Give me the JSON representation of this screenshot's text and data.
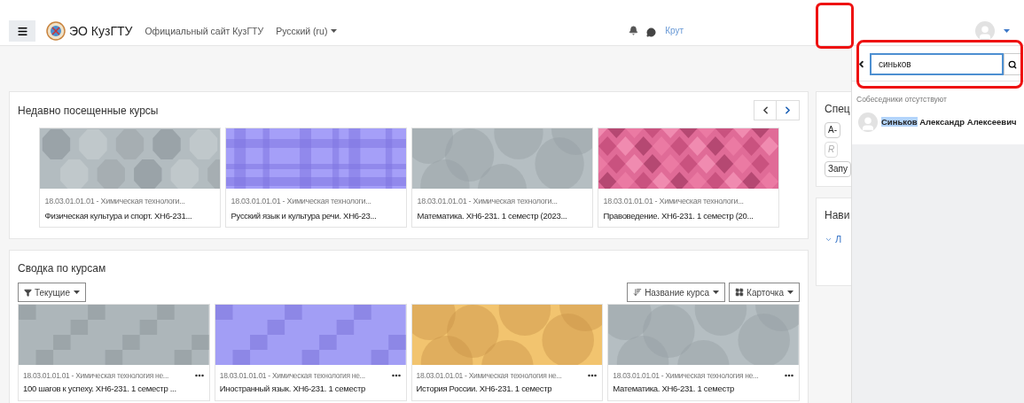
{
  "header": {
    "brand": "ЭО КузГТУ",
    "links": [
      {
        "label": "Официальный сайт КузГТУ",
        "dropdown": false
      },
      {
        "label": "Русский (ru)",
        "dropdown": true
      }
    ],
    "user_name": "Крут"
  },
  "recent": {
    "title": "Недавно посещенные курсы",
    "courses": [
      {
        "category": "18.03.01.01.01 - Химическая технологи...",
        "name": "Физическая культура и спорт. ХН6-231..."
      },
      {
        "category": "18.03.01.01.01 - Химическая технологи...",
        "name": "Русский язык и культура речи. ХН6-23..."
      },
      {
        "category": "18.03.01.01.01 - Химическая технологи...",
        "name": "Математика. ХН6-231. 1 семестр (2023..."
      },
      {
        "category": "18.03.01.01.01 - Химическая технологи...",
        "name": "Правоведение. ХН6-231. 1 семестр (20..."
      }
    ]
  },
  "overview": {
    "title": "Сводка по курсам",
    "filter": "Текущие",
    "sort": "Название курса",
    "view": "Карточка",
    "courses": [
      {
        "category": "18.03.01.01.01 - Химическая технология не...",
        "name": "100 шагов к успеху. ХН6-231. 1 семестр ..."
      },
      {
        "category": "18.03.01.01.01 - Химическая технология не...",
        "name": "Иностранный язык. ХН6-231. 1 семестр"
      },
      {
        "category": "18.03.01.01.01 - Химическая технология не...",
        "name": "История России. ХН6-231. 1 семестр"
      },
      {
        "category": "18.03.01.01.01 - Химическая технология не...",
        "name": "Математика. ХН6-231. 1 семестр"
      }
    ]
  },
  "sidebar": {
    "blocks": [
      {
        "kind": "buttons",
        "title": "Спец",
        "buttons": [
          {
            "label": "A-",
            "disabled": false
          },
          {
            "label": "R",
            "disabled": true
          },
          {
            "label": "Запу",
            "disabled": false
          }
        ]
      },
      {
        "kind": "tree",
        "title": "Нави",
        "items": [
          {
            "label": "Л",
            "expanded": true
          }
        ]
      }
    ]
  },
  "messages": {
    "search_value": "синьков",
    "empty_text": "Собеседники отсутствуют",
    "results": [
      {
        "name_parts": [
          {
            "text": "Синьков",
            "highlighted": true
          },
          {
            "text": "Александр Алексеевич",
            "highlighted": false
          }
        ]
      }
    ]
  }
}
